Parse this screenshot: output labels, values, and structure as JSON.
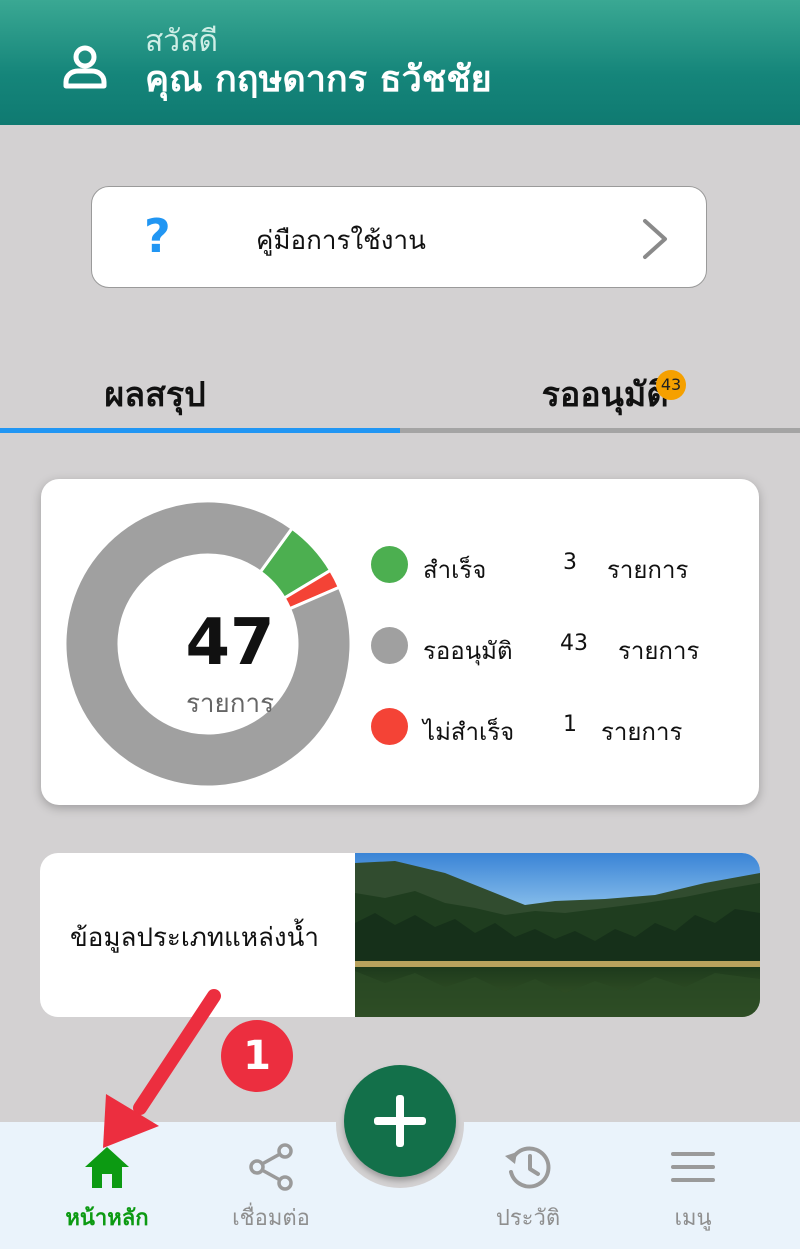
{
  "header": {
    "greeting": "สวัสดี",
    "username": "คุณ กฤษดากร ธวัชชัย"
  },
  "guide": {
    "icon_char": "?",
    "label": "คู่มือการใช้งาน"
  },
  "tabs": [
    {
      "label": "ผลสรุป",
      "active": true
    },
    {
      "label": "รออนุมัติ",
      "badge": "43",
      "active": false
    }
  ],
  "summary": {
    "total": "47",
    "unit": "รายการ",
    "items": [
      {
        "label": "สำเร็จ",
        "count": "3",
        "unit": "รายการ",
        "color": "#4caf50"
      },
      {
        "label": "รออนุมัติ",
        "count": "43",
        "unit": "รายการ",
        "color": "#a0a0a0"
      },
      {
        "label": "ไม่สำเร็จ",
        "count": "1",
        "unit": "รายการ",
        "color": "#f44336"
      }
    ]
  },
  "water_card": {
    "label": "ข้อมูลประเภทแหล่งน้ำ"
  },
  "annotation": {
    "step": "1"
  },
  "bottom_nav": {
    "home": "หน้าหลัก",
    "connect": "เชื่อมต่อ",
    "history": "ประวัติ",
    "menu": "เมนู"
  },
  "colors": {
    "header": "#15857a",
    "tab_active": "#2196f3",
    "home_active": "#0c9a12",
    "fab": "#13704a",
    "annotation": "#ec2e3f"
  }
}
